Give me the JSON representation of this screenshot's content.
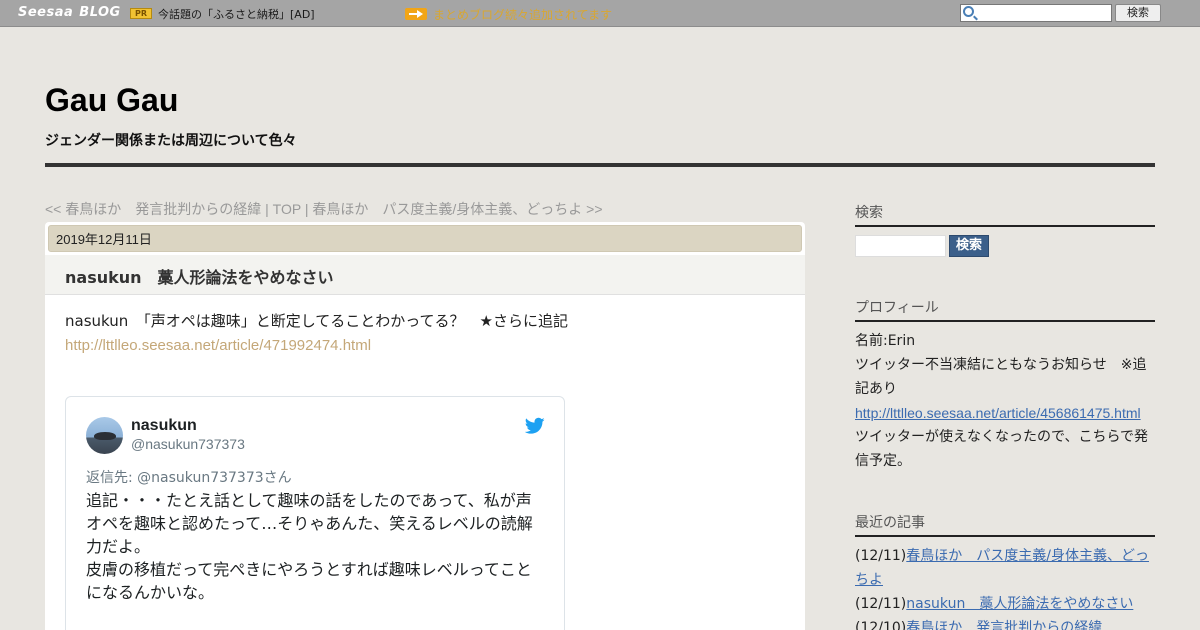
{
  "topbar": {
    "logo_main": "Seesaa",
    "logo_sub": "BLOG",
    "pr_label": "PR",
    "pr_text": "今話題の「ふるさと納税」[AD]",
    "notice_text": "まとめブログ続々追加されてます",
    "search_button": "検索"
  },
  "header": {
    "title": "Gau Gau",
    "description": "ジェンダー関係または周辺について色々"
  },
  "pager": {
    "prev": "<< 春鳥ほか　発言批判からの経緯",
    "sep1": " | ",
    "top": "TOP",
    "sep2": " | ",
    "next": "春鳥ほか　パス度主義/身体主義、どっちよ >>"
  },
  "article": {
    "date": "2019年12月11日",
    "title": "nasukun　藁人形論法をやめなさい",
    "body_line": "nasukun　「声オペは趣味」と断定してることわかってる？　★さらに追記",
    "link": "http://lttlleo.seesaa.net/article/471992474.html"
  },
  "tweet": {
    "name": "nasukun",
    "handle": "@nasukun737373",
    "reply_to": "返信先: @nasukun737373さん",
    "text": "追記・・・たとえ話として趣味の話をしたのであって、私が声オペを趣味と認めたって…そりゃあんた、笑えるレベルの読解力だよ。\n皮膚の移植だって完ぺきにやろうとすれば趣味レベルってことになるんかいな。\n\n痣の治療だって同じこと。金があればセラミックの白い痣を入"
  },
  "sidebar": {
    "search_heading": "検索",
    "search_button": "検索",
    "profile_heading": "プロフィール",
    "profile_name": "名前:Erin",
    "profile_notice": "ツイッター不当凍結にともなうお知らせ　※追記あり",
    "profile_link": "http://lttlleo.seesaa.net/article/456861475.html",
    "profile_note": "ツイッターが使えなくなったので、こちらで発信予定。",
    "recent_heading": "最近の記事",
    "recent": [
      {
        "date": "(12/11)",
        "title": "春鳥ほか　パス度主義/身体主義、どっちよ"
      },
      {
        "date": "(12/11)",
        "title": "nasukun　藁人形論法をやめなさい"
      },
      {
        "date": "(12/10)",
        "title": "春鳥ほか　発言批判からの経緯"
      }
    ]
  },
  "colors": {
    "page_bg": "#e8e6e1",
    "topbar_bg": "#a5a5a5",
    "date_bar": "#dbd5c2",
    "link_tan": "#c4a778",
    "link_blue": "#3b6bb0",
    "twitter_blue": "#1da1f2"
  }
}
